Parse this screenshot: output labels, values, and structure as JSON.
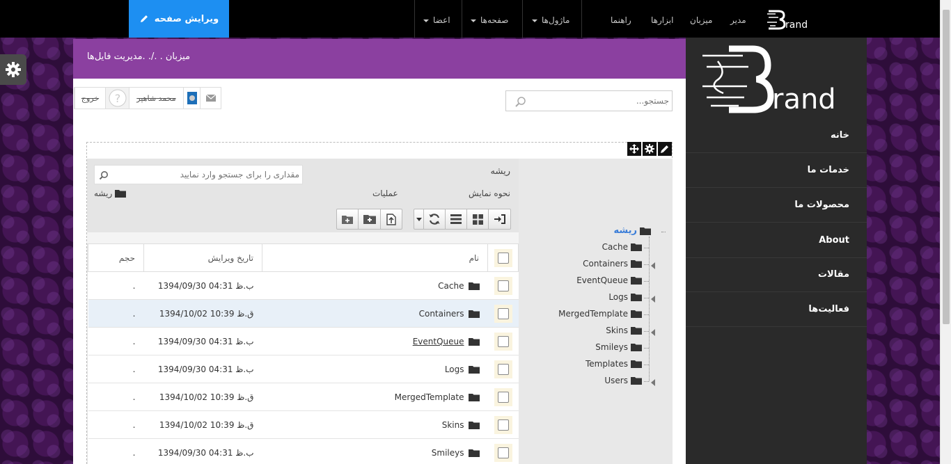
{
  "topbar": {
    "edit_page": "ویرایش صفحه",
    "menus": [
      "اعضا",
      "صفحه‌ها",
      "ماژول‌ها"
    ],
    "links": [
      "راهنما",
      "ابزارها",
      "میزبان",
      "مدیر"
    ],
    "logo_text": "rand"
  },
  "breadcrumb": "میزبان . ./. .مدیریت فایل‌ها",
  "user": {
    "logout": "خروج",
    "name": "محمد شاهپر"
  },
  "site_search": {
    "placeholder": "جستجو..."
  },
  "file_manager": {
    "root_label": "ریشه",
    "search_placeholder": "مقداری را برای جستجو وارد نمایید",
    "view_mode_label": "نحوه نمایش",
    "operations_label": "عملیات",
    "path_label": "ریشه",
    "columns": {
      "name": "نام",
      "modified": "تاریخ ویرایش",
      "size": "حجم"
    },
    "rows": [
      {
        "name": "Cache",
        "modified": "1394/09/30 04:31 ب.ظ",
        "size": "."
      },
      {
        "name": "Containers",
        "modified": "1394/10/02 10:39 ق.ظ",
        "size": "."
      },
      {
        "name": "EventQueue",
        "modified": "1394/09/30 04:31 ب.ظ",
        "size": "."
      },
      {
        "name": "Logs",
        "modified": "1394/09/30 04:31 ب.ظ",
        "size": "."
      },
      {
        "name": "MergedTemplate",
        "modified": "1394/10/02 10:39 ق.ظ",
        "size": "."
      },
      {
        "name": "Skins",
        "modified": "1394/10/02 10:39 ق.ظ",
        "size": "."
      },
      {
        "name": "Smileys",
        "modified": "1394/09/30 04:31 ب.ظ",
        "size": "."
      }
    ],
    "tree": {
      "root": "ریشه",
      "items": [
        "Cache",
        "Containers",
        "EventQueue",
        "Logs",
        "MergedTemplate",
        "Skins",
        "Smileys",
        "Templates",
        "Users"
      ]
    }
  },
  "sidebar": {
    "logo_text": "rand",
    "nav": [
      "خانه",
      "خدمات ما",
      "محصولات ما",
      "About",
      "مقالات",
      "فعالیت‌ها"
    ]
  },
  "colors": {
    "accent_blue": "#1d8ff2",
    "breadcrumb_purple": "#8b40a0",
    "sidebar_bg": "#2a2a2a",
    "tree_root_link": "#3a7dd8"
  }
}
